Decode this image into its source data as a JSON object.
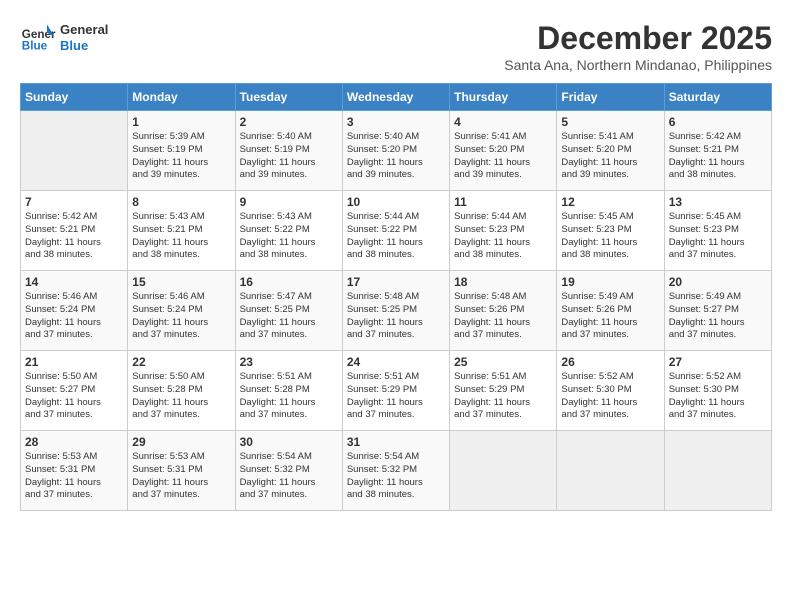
{
  "header": {
    "logo_line1": "General",
    "logo_line2": "Blue",
    "month": "December 2025",
    "location": "Santa Ana, Northern Mindanao, Philippines"
  },
  "days_of_week": [
    "Sunday",
    "Monday",
    "Tuesday",
    "Wednesday",
    "Thursday",
    "Friday",
    "Saturday"
  ],
  "weeks": [
    [
      {
        "day": "",
        "info": ""
      },
      {
        "day": "1",
        "info": "Sunrise: 5:39 AM\nSunset: 5:19 PM\nDaylight: 11 hours\nand 39 minutes."
      },
      {
        "day": "2",
        "info": "Sunrise: 5:40 AM\nSunset: 5:19 PM\nDaylight: 11 hours\nand 39 minutes."
      },
      {
        "day": "3",
        "info": "Sunrise: 5:40 AM\nSunset: 5:20 PM\nDaylight: 11 hours\nand 39 minutes."
      },
      {
        "day": "4",
        "info": "Sunrise: 5:41 AM\nSunset: 5:20 PM\nDaylight: 11 hours\nand 39 minutes."
      },
      {
        "day": "5",
        "info": "Sunrise: 5:41 AM\nSunset: 5:20 PM\nDaylight: 11 hours\nand 39 minutes."
      },
      {
        "day": "6",
        "info": "Sunrise: 5:42 AM\nSunset: 5:21 PM\nDaylight: 11 hours\nand 38 minutes."
      }
    ],
    [
      {
        "day": "7",
        "info": "Sunrise: 5:42 AM\nSunset: 5:21 PM\nDaylight: 11 hours\nand 38 minutes."
      },
      {
        "day": "8",
        "info": "Sunrise: 5:43 AM\nSunset: 5:21 PM\nDaylight: 11 hours\nand 38 minutes."
      },
      {
        "day": "9",
        "info": "Sunrise: 5:43 AM\nSunset: 5:22 PM\nDaylight: 11 hours\nand 38 minutes."
      },
      {
        "day": "10",
        "info": "Sunrise: 5:44 AM\nSunset: 5:22 PM\nDaylight: 11 hours\nand 38 minutes."
      },
      {
        "day": "11",
        "info": "Sunrise: 5:44 AM\nSunset: 5:23 PM\nDaylight: 11 hours\nand 38 minutes."
      },
      {
        "day": "12",
        "info": "Sunrise: 5:45 AM\nSunset: 5:23 PM\nDaylight: 11 hours\nand 38 minutes."
      },
      {
        "day": "13",
        "info": "Sunrise: 5:45 AM\nSunset: 5:23 PM\nDaylight: 11 hours\nand 37 minutes."
      }
    ],
    [
      {
        "day": "14",
        "info": "Sunrise: 5:46 AM\nSunset: 5:24 PM\nDaylight: 11 hours\nand 37 minutes."
      },
      {
        "day": "15",
        "info": "Sunrise: 5:46 AM\nSunset: 5:24 PM\nDaylight: 11 hours\nand 37 minutes."
      },
      {
        "day": "16",
        "info": "Sunrise: 5:47 AM\nSunset: 5:25 PM\nDaylight: 11 hours\nand 37 minutes."
      },
      {
        "day": "17",
        "info": "Sunrise: 5:48 AM\nSunset: 5:25 PM\nDaylight: 11 hours\nand 37 minutes."
      },
      {
        "day": "18",
        "info": "Sunrise: 5:48 AM\nSunset: 5:26 PM\nDaylight: 11 hours\nand 37 minutes."
      },
      {
        "day": "19",
        "info": "Sunrise: 5:49 AM\nSunset: 5:26 PM\nDaylight: 11 hours\nand 37 minutes."
      },
      {
        "day": "20",
        "info": "Sunrise: 5:49 AM\nSunset: 5:27 PM\nDaylight: 11 hours\nand 37 minutes."
      }
    ],
    [
      {
        "day": "21",
        "info": "Sunrise: 5:50 AM\nSunset: 5:27 PM\nDaylight: 11 hours\nand 37 minutes."
      },
      {
        "day": "22",
        "info": "Sunrise: 5:50 AM\nSunset: 5:28 PM\nDaylight: 11 hours\nand 37 minutes."
      },
      {
        "day": "23",
        "info": "Sunrise: 5:51 AM\nSunset: 5:28 PM\nDaylight: 11 hours\nand 37 minutes."
      },
      {
        "day": "24",
        "info": "Sunrise: 5:51 AM\nSunset: 5:29 PM\nDaylight: 11 hours\nand 37 minutes."
      },
      {
        "day": "25",
        "info": "Sunrise: 5:51 AM\nSunset: 5:29 PM\nDaylight: 11 hours\nand 37 minutes."
      },
      {
        "day": "26",
        "info": "Sunrise: 5:52 AM\nSunset: 5:30 PM\nDaylight: 11 hours\nand 37 minutes."
      },
      {
        "day": "27",
        "info": "Sunrise: 5:52 AM\nSunset: 5:30 PM\nDaylight: 11 hours\nand 37 minutes."
      }
    ],
    [
      {
        "day": "28",
        "info": "Sunrise: 5:53 AM\nSunset: 5:31 PM\nDaylight: 11 hours\nand 37 minutes."
      },
      {
        "day": "29",
        "info": "Sunrise: 5:53 AM\nSunset: 5:31 PM\nDaylight: 11 hours\nand 37 minutes."
      },
      {
        "day": "30",
        "info": "Sunrise: 5:54 AM\nSunset: 5:32 PM\nDaylight: 11 hours\nand 37 minutes."
      },
      {
        "day": "31",
        "info": "Sunrise: 5:54 AM\nSunset: 5:32 PM\nDaylight: 11 hours\nand 38 minutes."
      },
      {
        "day": "",
        "info": ""
      },
      {
        "day": "",
        "info": ""
      },
      {
        "day": "",
        "info": ""
      }
    ]
  ]
}
